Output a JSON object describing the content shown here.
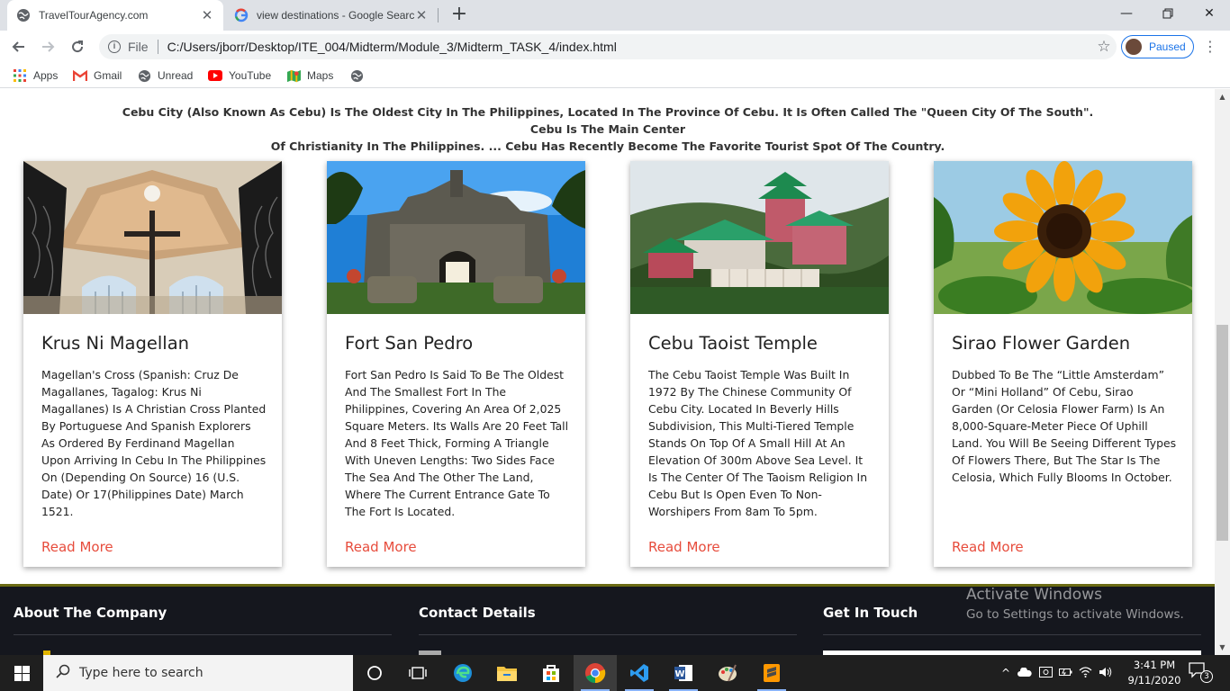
{
  "browser": {
    "tabs": [
      {
        "title": "TravelTourAgency.com",
        "active": true
      },
      {
        "title": "view destinations - Google Searc",
        "active": false
      }
    ],
    "address": {
      "scheme": "File",
      "url": "C:/Users/jborr/Desktop/ITE_004/Midterm/Module_3/Midterm_TASK_4/index.html"
    },
    "profile_status": "Paused",
    "bookmarks": [
      "Apps",
      "Gmail",
      "Unread",
      "YouTube",
      "Maps"
    ]
  },
  "page": {
    "intro_line1": "Cebu City (Also Known As Cebu) Is The Oldest City In The Philippines, Located In The Province Of Cebu. It Is Often Called The \"Queen City Of The South\". Cebu Is The Main Center",
    "intro_line2": "Of Christianity In The Philippines. ... Cebu Has Recently Become The Favorite Tourist Spot Of The Country.",
    "cards": [
      {
        "title": "Krus Ni Magellan",
        "text": "Magellan's Cross (Spanish: Cruz De Magallanes, Tagalog: Krus Ni Magallanes) Is A Christian Cross Planted By Portuguese And Spanish Explorers As Ordered By Ferdinand Magellan Upon Arriving In Cebu In The Philippines On (Depending On Source) 16 (U.S. Date) Or 17(Philippines Date) March 1521.",
        "link": "Read More"
      },
      {
        "title": "Fort San Pedro",
        "text": "Fort San Pedro Is Said To Be The Oldest And The Smallest Fort In The Philippines, Covering An Area Of 2,025 Square Meters. Its Walls Are 20 Feet Tall And 8 Feet Thick, Forming A Triangle With Uneven Lengths: Two Sides Face The Sea And The Other The Land, Where The Current Entrance Gate To The Fort Is Located.",
        "link": "Read More"
      },
      {
        "title": "Cebu Taoist Temple",
        "text": "The Cebu Taoist Temple Was Built In 1972 By The Chinese Community Of Cebu City. Located In Beverly Hills Subdivision, This Multi-Tiered Temple Stands On Top Of A Small Hill At An Elevation Of 300m Above Sea Level. It Is The Center Of The Taoism Religion In Cebu But Is Open Even To Non-Worshipers From 8am To 5pm.",
        "link": "Read More"
      },
      {
        "title": "Sirao Flower Garden",
        "text": "Dubbed To Be The “Little Amsterdam” Or “Mini Holland” Of Cebu, Sirao Garden (Or Celosia Flower Farm) Is An 8,000-Square-Meter Piece Of Uphill Land. You Will Be Seeing Different Types Of Flowers There, But The Star Is The Celosia, Which Fully Blooms In October.",
        "link": "Read More"
      }
    ],
    "footer": {
      "about": "About The Company",
      "contact": "Contact Details",
      "touch": "Get In Touch"
    },
    "watermark": {
      "line1": "Activate Windows",
      "line2": "Go to Settings to activate Windows."
    }
  },
  "taskbar": {
    "search_placeholder": "Type here to search",
    "time": "3:41 PM",
    "date": "9/11/2020",
    "notification_count": "3"
  },
  "colors": {
    "accent_link": "#e74c3c",
    "footer_bg": "#15171e",
    "chrome_tabstrip": "#dee1e6"
  }
}
